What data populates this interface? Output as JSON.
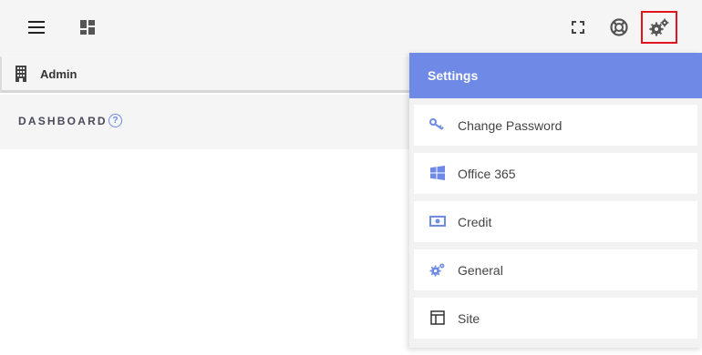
{
  "topbar": {
    "icons": [
      "menu-icon",
      "dashboard-grid-icon",
      "fullscreen-icon",
      "lifebuoy-icon",
      "gears-icon"
    ]
  },
  "breadcrumb": {
    "label": "Admin",
    "icon": "building-icon"
  },
  "dashboard": {
    "title": "DASHBOARD",
    "help_icon": "help-icon"
  },
  "settings": {
    "title": "Settings",
    "accent": "#6e8ae6",
    "items": [
      {
        "label": "Change Password",
        "icon": "key-icon"
      },
      {
        "label": "Office 365",
        "icon": "windows-icon"
      },
      {
        "label": "Credit",
        "icon": "money-icon"
      },
      {
        "label": "General",
        "icon": "gears-icon"
      },
      {
        "label": "Site",
        "icon": "layout-icon"
      }
    ]
  }
}
